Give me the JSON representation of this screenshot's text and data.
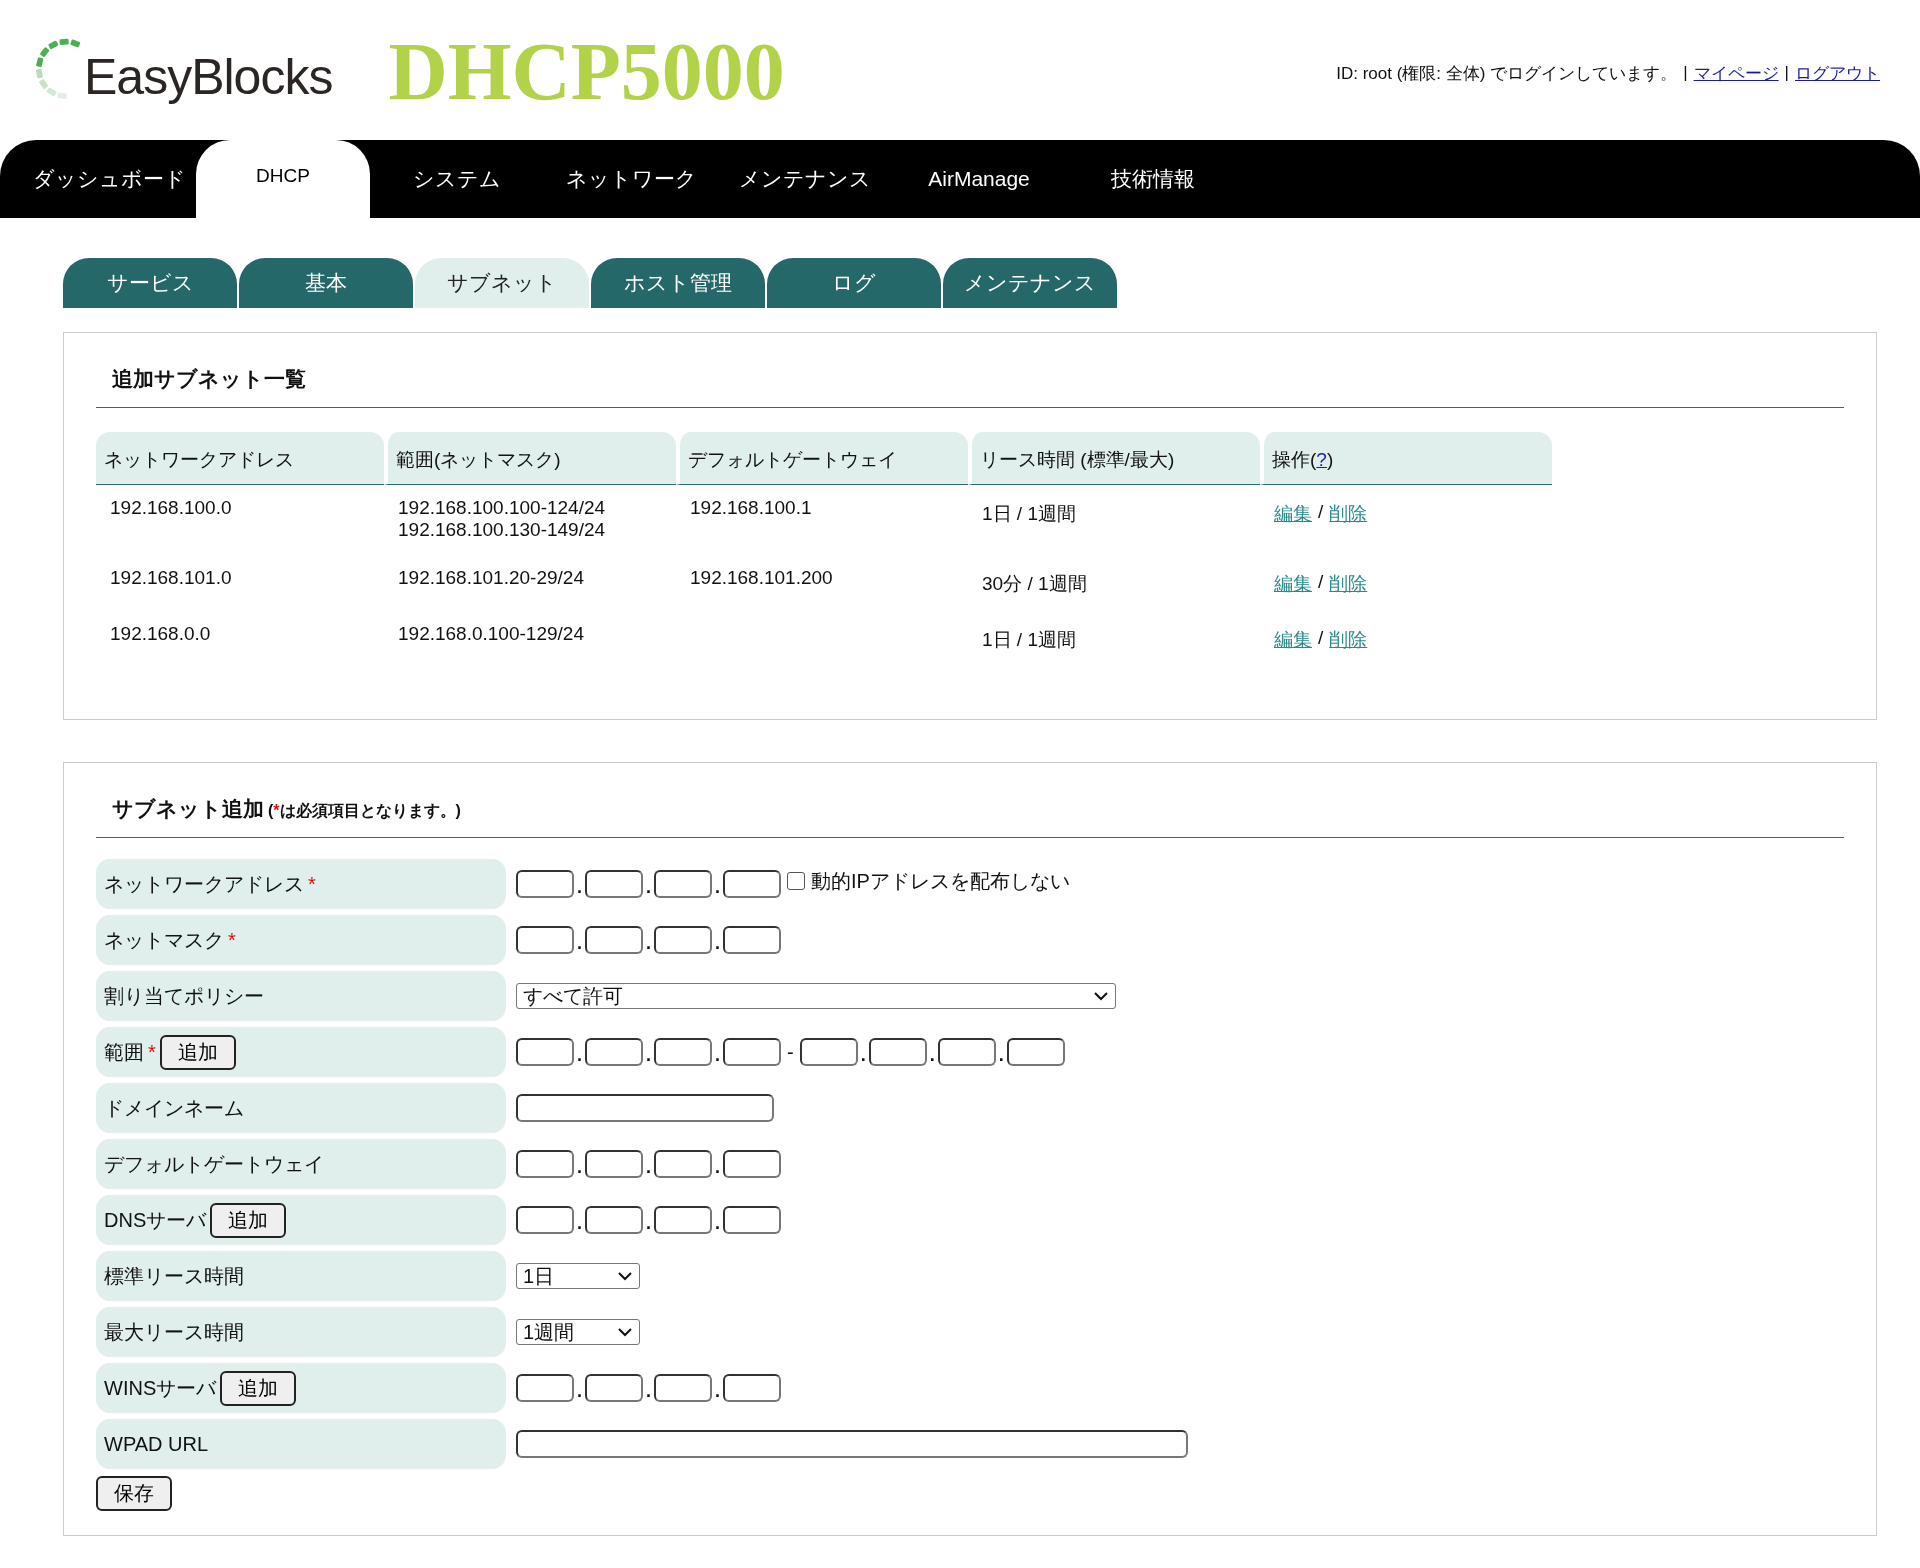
{
  "header": {
    "logo_text": "EasyBlocks",
    "product": "DHCP5000",
    "login_text": "ID: root (権限: 全体) でログインしています。",
    "separator": "|",
    "links": [
      "マイページ",
      "ログアウト"
    ]
  },
  "nav": [
    {
      "label": "ダッシュボード",
      "selected": false
    },
    {
      "label": "DHCP",
      "selected": true
    },
    {
      "label": "システム",
      "selected": false
    },
    {
      "label": "ネットワーク",
      "selected": false
    },
    {
      "label": "メンテナンス",
      "selected": false
    },
    {
      "label": "AirManage",
      "selected": false
    },
    {
      "label": "技術情報",
      "selected": false
    }
  ],
  "subtabs": [
    {
      "label": "サービス",
      "selected": false
    },
    {
      "label": "基本",
      "selected": false
    },
    {
      "label": "サブネット",
      "selected": true
    },
    {
      "label": "ホスト管理",
      "selected": false
    },
    {
      "label": "ログ",
      "selected": false
    },
    {
      "label": "メンテナンス",
      "selected": false
    }
  ],
  "subnet_list": {
    "title": "追加サブネット一覧",
    "columns": [
      "ネットワークアドレス",
      "範囲(ネットマスク)",
      "デフォルトゲートウェイ",
      "リース時間 (標準/最大)"
    ],
    "ops_column": {
      "label": "操作(",
      "help": "?",
      "close": ")"
    },
    "rows": [
      {
        "network": "192.168.100.0",
        "ranges": [
          "192.168.100.100-124/24",
          "192.168.100.130-149/24"
        ],
        "gateway": "192.168.100.1",
        "lease": "1日 / 1週間",
        "actions": [
          "編集",
          "削除"
        ]
      },
      {
        "network": "192.168.101.0",
        "ranges": [
          "192.168.101.20-29/24"
        ],
        "gateway": "192.168.101.200",
        "lease": "30分 / 1週間",
        "actions": [
          "編集",
          "削除"
        ]
      },
      {
        "network": "192.168.0.0",
        "ranges": [
          "192.168.0.100-129/24"
        ],
        "lease": "1日 / 1週間",
        "actions": [
          "編集",
          "削除"
        ]
      }
    ],
    "action_separator": "/"
  },
  "subnet_add": {
    "title": "サブネット追加",
    "note_open": "(",
    "required_mark": "*",
    "note_rest": "は必須項目となります。)",
    "octet_separator": ".",
    "range_separator": "-",
    "rows": [
      {
        "label": "ネットワークアドレス",
        "required": true,
        "kind": "ip",
        "checkbox": {
          "label": "動的IPアドレスを配布しない",
          "checked": false
        }
      },
      {
        "label": "ネットマスク",
        "required": true,
        "kind": "ip"
      },
      {
        "label": "割り当てポリシー",
        "required": false,
        "kind": "select-wide",
        "value": "すべて許可"
      },
      {
        "label": "範囲",
        "required": true,
        "kind": "ip-range",
        "add_button": "追加"
      },
      {
        "label": "ドメインネーム",
        "required": false,
        "kind": "text"
      },
      {
        "label": "デフォルトゲートウェイ",
        "required": false,
        "kind": "ip"
      },
      {
        "label": "DNSサーバ",
        "required": false,
        "kind": "ip",
        "add_button": "追加"
      },
      {
        "label": "標準リース時間",
        "required": false,
        "kind": "select",
        "value": "1日"
      },
      {
        "label": "最大リース時間",
        "required": false,
        "kind": "select",
        "value": "1週間"
      },
      {
        "label": "WINSサーバ",
        "required": false,
        "kind": "ip",
        "add_button": "追加"
      },
      {
        "label": "WPAD URL",
        "required": false,
        "kind": "text-wide"
      }
    ],
    "save_button": "保存"
  }
}
